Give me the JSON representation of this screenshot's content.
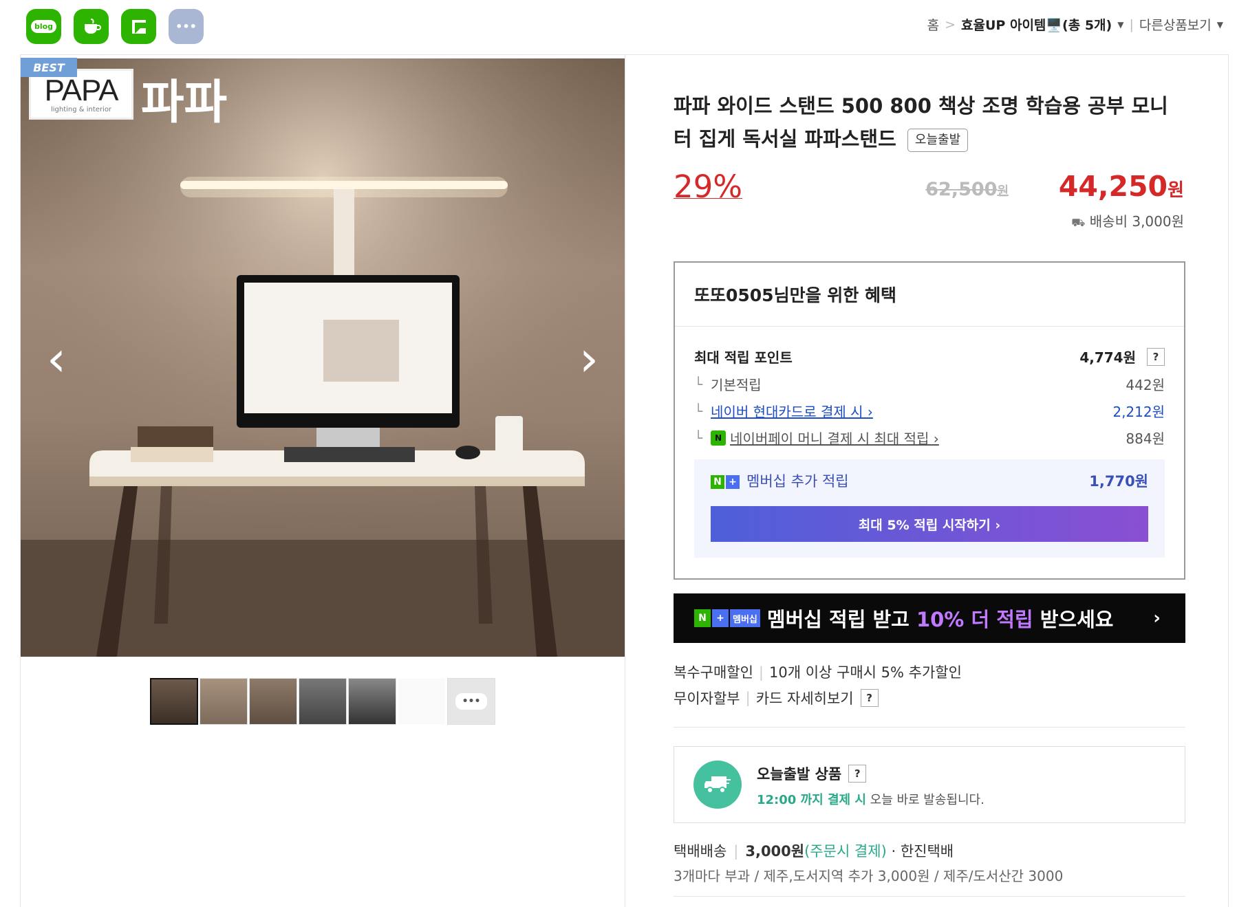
{
  "share": [
    {
      "name": "blog",
      "label": "blog",
      "color": "#2db400"
    },
    {
      "name": "cafe",
      "label": "",
      "color": "#2db400"
    },
    {
      "name": "band",
      "label": "",
      "color": "#2db400"
    },
    {
      "name": "more",
      "label": "•••",
      "color": "#a9b7d4"
    }
  ],
  "breadcrumb": {
    "home": "홈",
    "category": "효율UP 아이템🖥️(총 5개)",
    "other": "다른상품보기"
  },
  "gallery": {
    "badge": "BEST",
    "brand_logo": "PAPA",
    "brand_logo_sub": "lighting & interior",
    "brand_korean": "파파",
    "prev": "‹",
    "next": "›",
    "thumbnail_count": 7
  },
  "product": {
    "title": "파파 와이드 스탠드 500 800 책상 조명 학습용 공부 모니터 집게 독서실 파파스탠드",
    "tag": "오늘출발",
    "discount": "29%",
    "original_price": "62,500",
    "original_unit": "원",
    "sale_price": "44,250",
    "sale_unit": "원",
    "shipping": "배송비 3,000원"
  },
  "benefit": {
    "heading": "또또0505님만을 위한 혜택",
    "max_points_label": "최대 적립 포인트",
    "max_points_value": "4,774원",
    "rows": [
      {
        "label": "기본적립",
        "value": "442원"
      },
      {
        "label": "네이버 현대카드로 결제 시 ›",
        "value": "2,212원"
      },
      {
        "label": "네이버페이 머니 결제 시 최대 적립 ›",
        "value": "884원"
      }
    ],
    "membership_label": "멤버십 추가 적립",
    "membership_value": "1,770원",
    "membership_button": "최대 5% 적립 시작하기 ›"
  },
  "banner": {
    "badge": "멤버십",
    "text_a": "멤버십 적립 받고 ",
    "text_b": "10% 더 적립",
    "text_c": " 받으세요",
    "chevron": "›"
  },
  "promo": {
    "multi_label": "복수구매할인",
    "multi_value": "10개 이상 구매시 5% 추가할인",
    "installment_label": "무이자할부",
    "installment_value": "카드 자세히보기"
  },
  "today_ship": {
    "title": "오늘출발 상품",
    "time": "12:00 까지 결제 시",
    "desc": " 오늘 바로 발송됩니다."
  },
  "delivery": {
    "method": "택배배송",
    "fee": "3,000원",
    "note": "(주문시 결제)",
    "courier": "· 한진택배",
    "extra": "3개마다 부과 / 제주,도서지역 추가 3,000원 / 제주/도서산간 3000"
  },
  "colors": {
    "accent_red": "#d52829",
    "naver_green": "#2db400",
    "link_blue": "#1d4dc2",
    "teal": "#46c1a0"
  }
}
